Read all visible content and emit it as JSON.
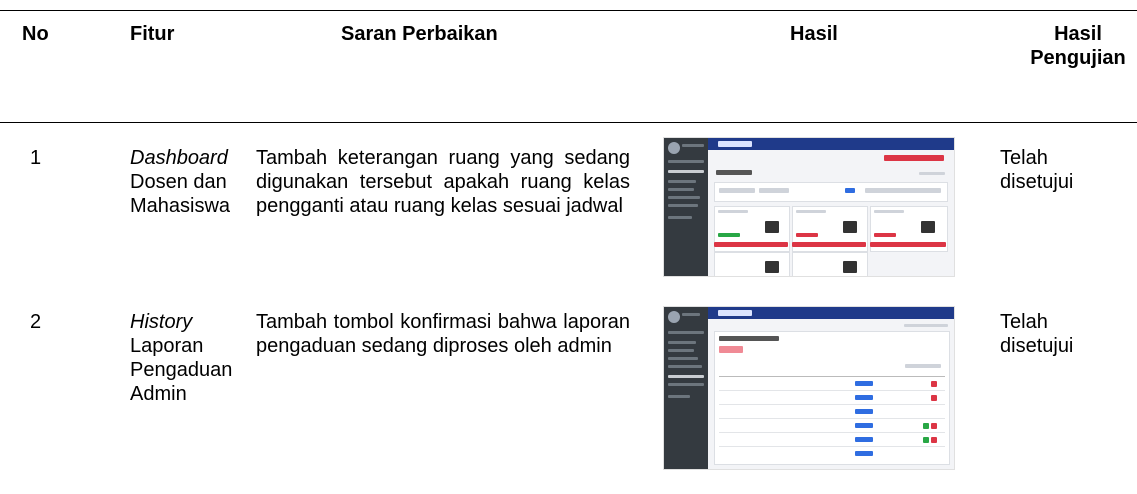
{
  "table": {
    "headers": [
      "No",
      "Fitur",
      "Saran Perbaikan",
      "Hasil",
      "Hasil Pengujian"
    ],
    "rows": [
      {
        "no": "1",
        "fitur_italic": "Dashboard",
        "fitur_rest": "Dosen dan Mahasiswa",
        "saran": "Tambah keterangan ruang yang sedang digunakan tersebut apakah ruang kelas pengganti atau ruang kelas sesuai jadwal",
        "hasil_pengujian": "Telah disetujui"
      },
      {
        "no": "2",
        "fitur_italic": "History",
        "fitur_rest": "Laporan Pengaduan Admin",
        "saran": "Tambah tombol konfirmasi bahwa laporan pengaduan sedang diproses oleh admin",
        "hasil_pengujian": "Telah disetujui"
      }
    ]
  },
  "thumbnails": {
    "dashboard": {
      "app_name": "SIRUANGKU",
      "title": "Dashboard",
      "colors": {
        "sidebar": "#343a40",
        "navbar": "#1f3a8a",
        "danger": "#dc3545",
        "success": "#28a745",
        "primary": "#2f6de1"
      }
    },
    "history": {
      "app_name": "SIRUANGKU",
      "title": "History Laporan Pengaduan",
      "colors": {
        "sidebar": "#343a40",
        "navbar": "#1f3a8a",
        "danger": "#dc3545",
        "success": "#28a745",
        "primary": "#2f6de1"
      }
    }
  }
}
